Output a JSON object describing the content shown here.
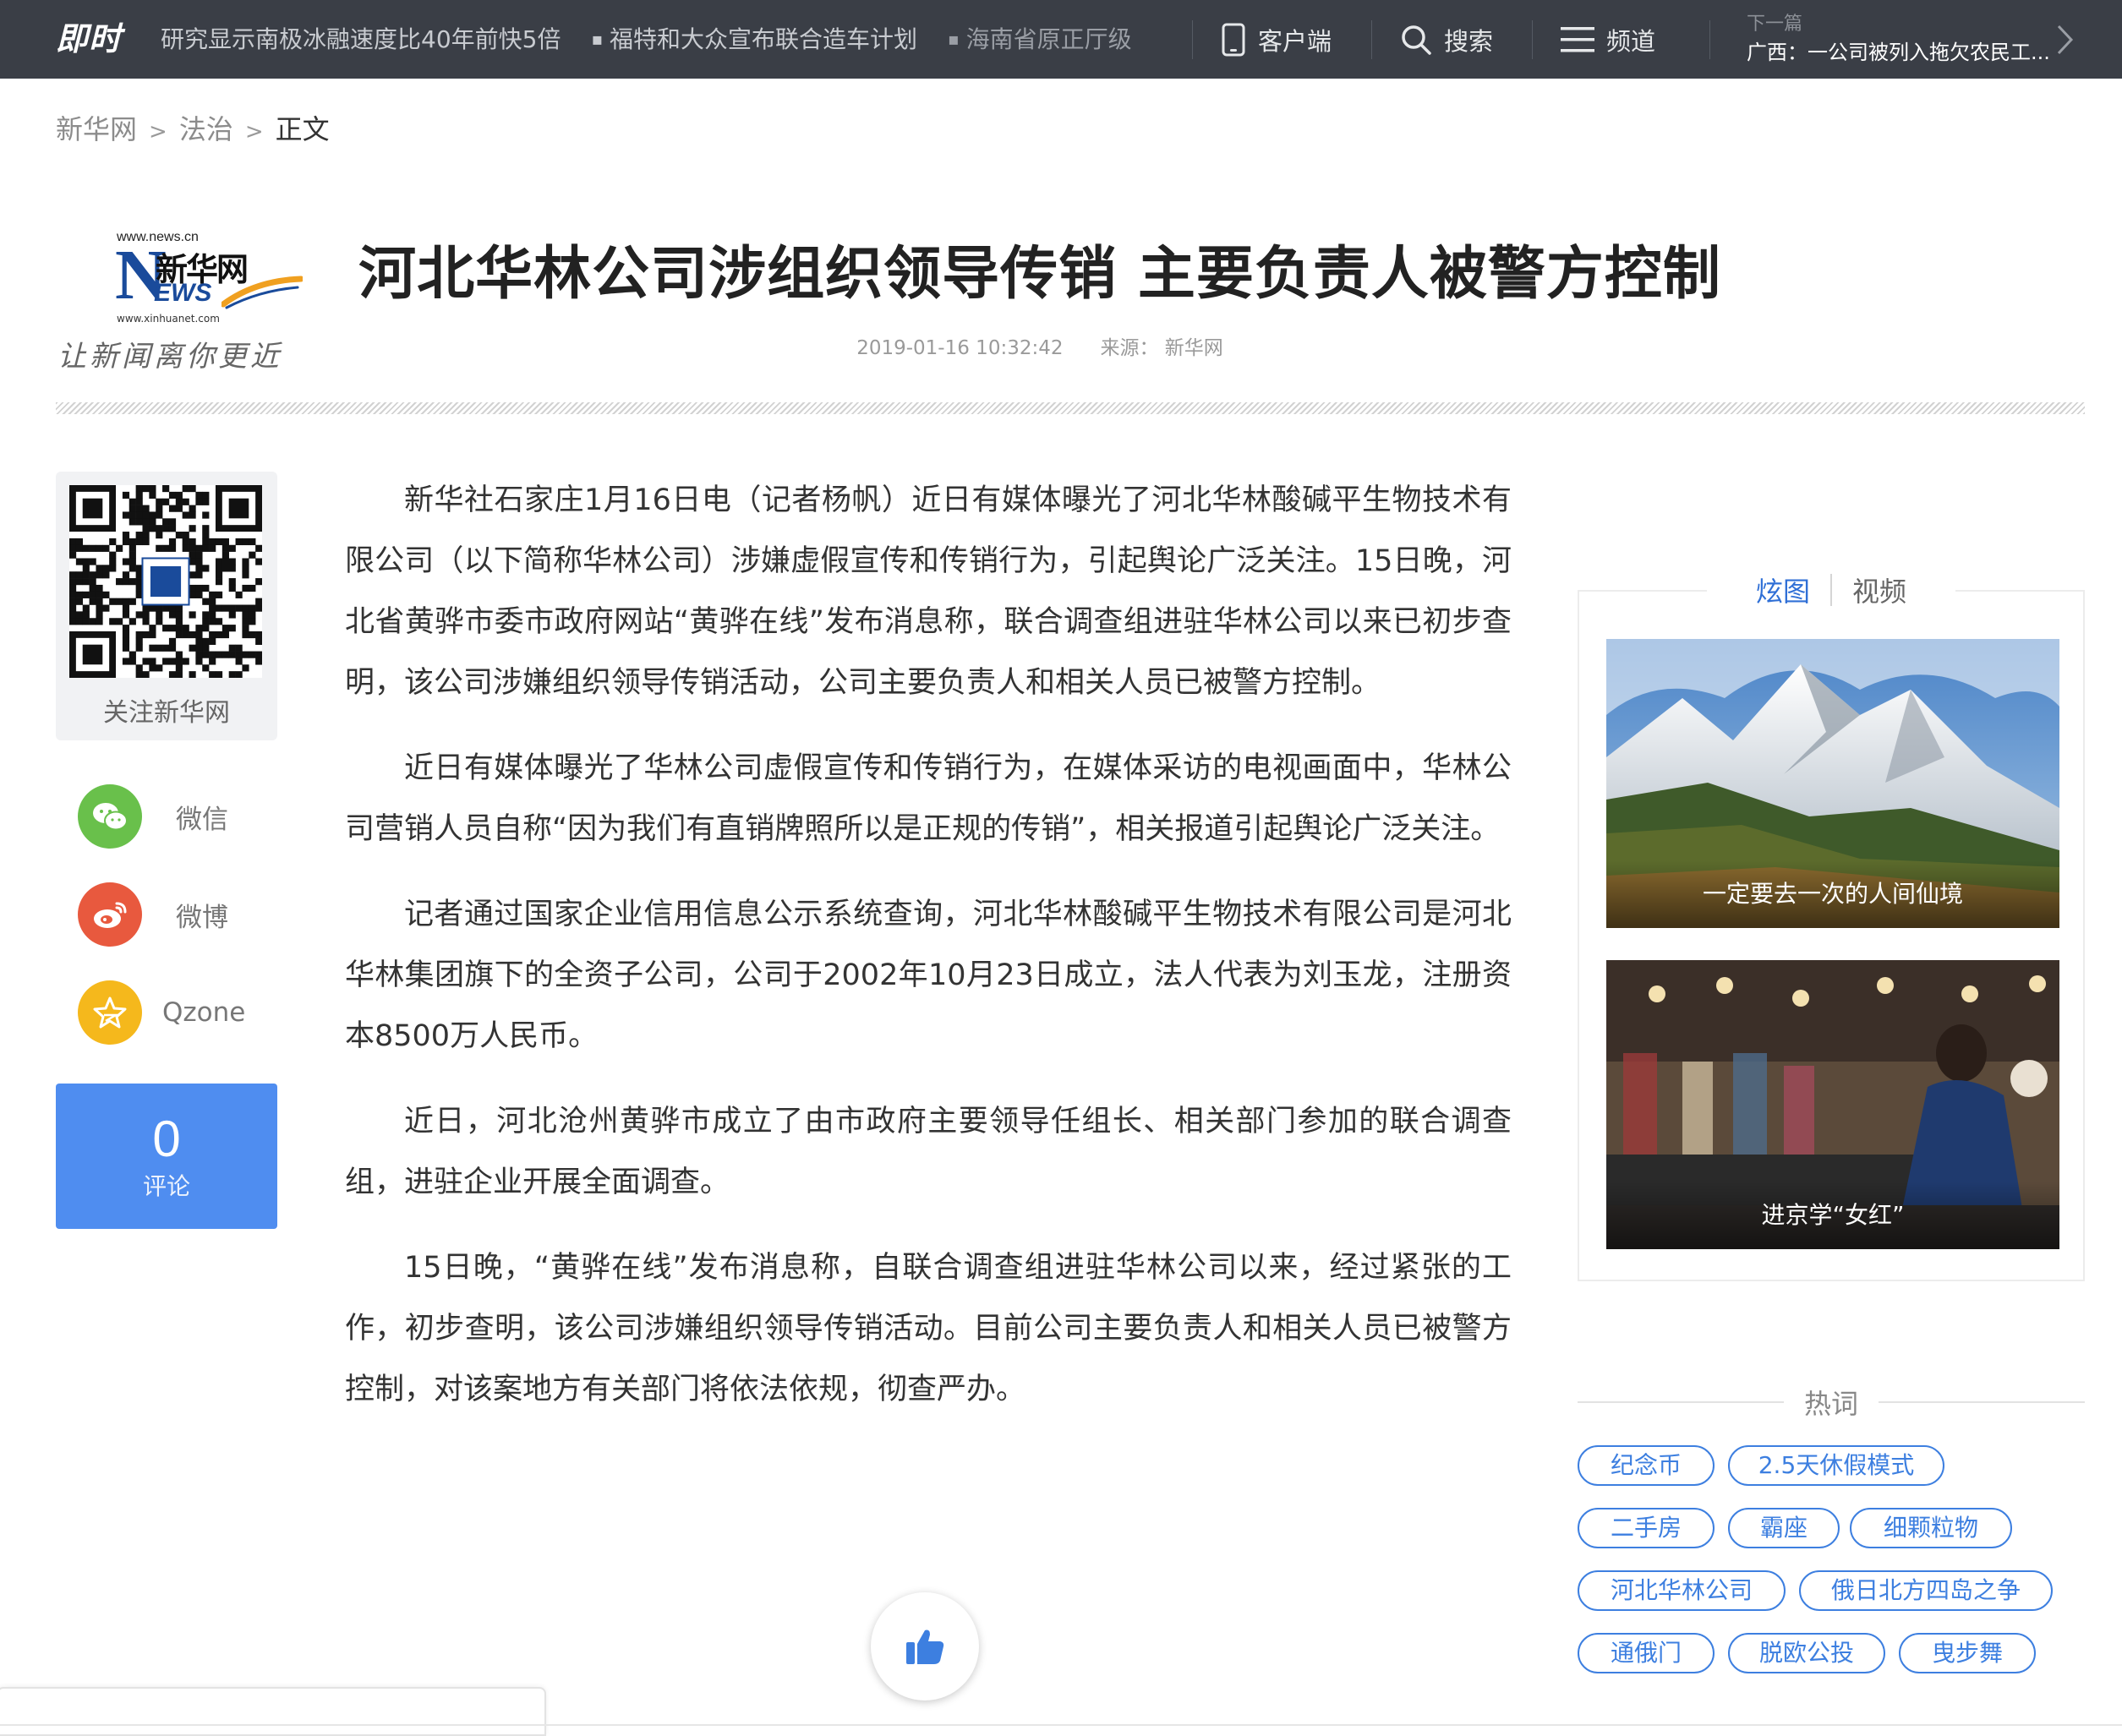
{
  "topbar": {
    "logo": "即时",
    "ticker": [
      "研究显示南极冰融速度比40年前快5倍",
      "福特和大众宣布联合造车计划",
      "海南省原正厅级"
    ],
    "client_label": "客户端",
    "search_label": "搜索",
    "channel_label": "频道",
    "next_label": "下一篇",
    "next_title": "广西：一公司被列入拖欠农民工..."
  },
  "breadcrumb": {
    "home": "新华网",
    "section": "法治",
    "current": "正文",
    "sep": ">"
  },
  "logo": {
    "url": "www.news.cn",
    "name_cn": "新华网",
    "n": "N",
    "ews": "EWS",
    "domain": "www.xinhuanet.com",
    "slogan": "让新闻离你更近"
  },
  "article": {
    "title": "河北华林公司涉组织领导传销 主要负责人被警方控制",
    "datetime": "2019-01-16 10:32:42",
    "source": "来源：  新华网",
    "paragraphs": [
      "新华社石家庄1月16日电（记者杨帆）近日有媒体曝光了河北华林酸碱平生物技术有限公司（以下简称华林公司）涉嫌虚假宣传和传销行为，引起舆论广泛关注。15日晚，河北省黄骅市委市政府网站“黄骅在线”发布消息称，联合调查组进驻华林公司以来已初步查明，该公司涉嫌组织领导传销活动，公司主要负责人和相关人员已被警方控制。",
      "近日有媒体曝光了华林公司虚假宣传和传销行为，在媒体采访的电视画面中，华林公司营销人员自称“因为我们有直销牌照所以是正规的传销”，相关报道引起舆论广泛关注。",
      "记者通过国家企业信用信息公示系统查询，河北华林酸碱平生物技术有限公司是河北华林集团旗下的全资子公司，公司于2002年10月23日成立，法人代表为刘玉龙，注册资本8500万人民币。",
      "近日，河北沧州黄骅市成立了由市政府主要领导任组长、相关部门参加的联合调查组，进驻企业开展全面调查。",
      "15日晚，“黄骅在线”发布消息称，自联合调查组进驻华林公司以来，经过紧张的工作，初步查明，该公司涉嫌组织领导传销活动。目前公司主要负责人和相关人员已被警方控制，对该案地方有关部门将依法依规，彻查严办。"
    ]
  },
  "share": {
    "qr_label": "关注新华网",
    "wechat": "微信",
    "weibo": "微博",
    "qzone": "Qzone",
    "comment_count": "0",
    "comment_label": "评论"
  },
  "sidebar": {
    "tabs": [
      "炫图",
      "视频"
    ],
    "photos": [
      {
        "caption": "一定要去一次的人间仙境"
      },
      {
        "caption": "进京学“女红”"
      }
    ],
    "hot_title": "热词",
    "tags": [
      "纪念币",
      "2.5天休假模式",
      "二手房",
      "霸座",
      "细颗粒物",
      "河北华林公司",
      "俄日北方四岛之争",
      "通俄门",
      "脱欧公投",
      "曳步舞"
    ]
  },
  "colors": {
    "topbar_bg": "#3a3e46",
    "accent_blue": "#3d7fe0",
    "comment_bg": "#4f8df0",
    "wechat_green": "#69c04b",
    "weibo_red": "#e8593e",
    "qzone_yellow": "#f5b81c"
  },
  "icons": [
    "phone-icon",
    "search-icon",
    "menu-icon",
    "chevron-right-icon",
    "wechat-icon",
    "weibo-icon",
    "qzone-star-icon",
    "thumbs-up-icon",
    "qr-code"
  ]
}
